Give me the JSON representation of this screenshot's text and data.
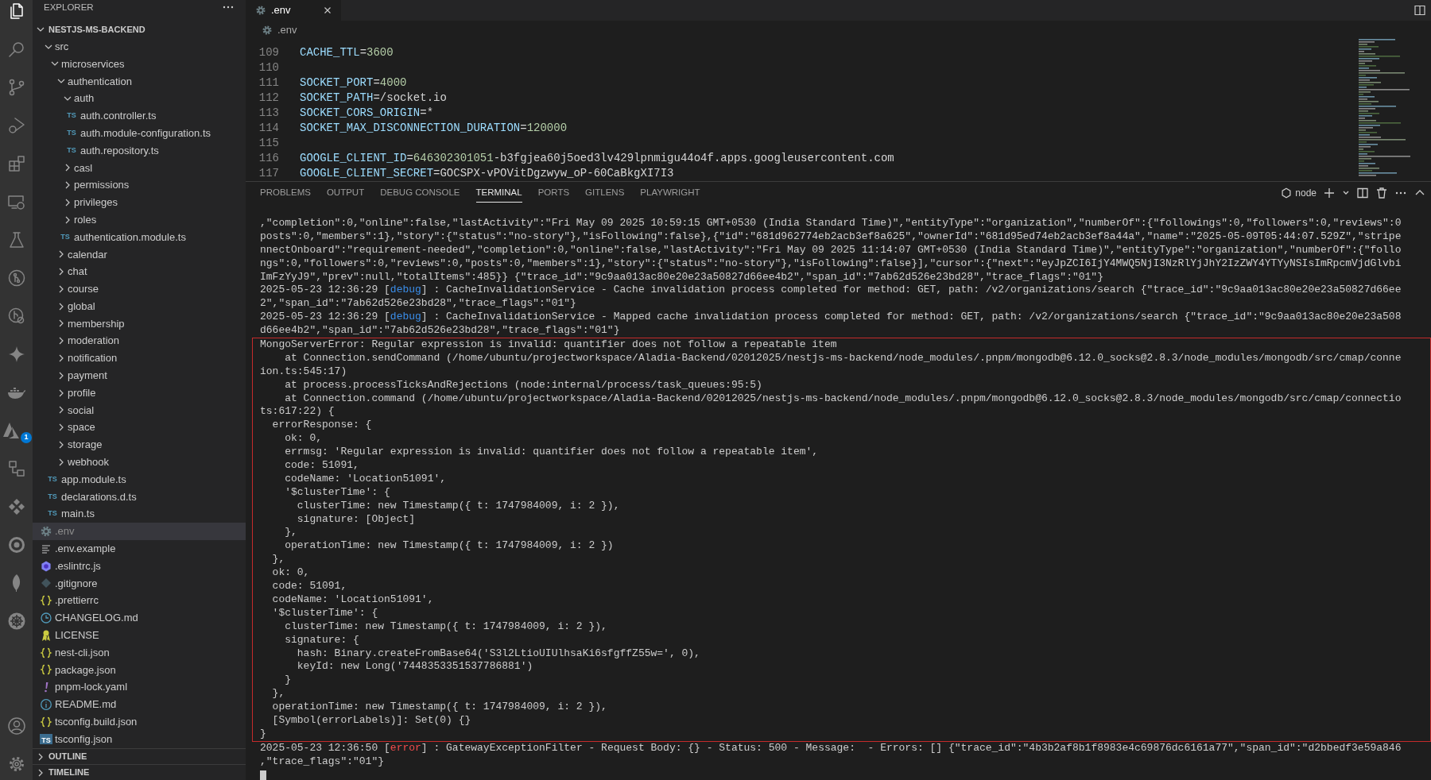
{
  "activity": {
    "items": [
      {
        "kind": "files",
        "selected": true
      },
      {
        "kind": "search",
        "selected": false
      },
      {
        "kind": "branch",
        "selected": false
      },
      {
        "kind": "run",
        "selected": false
      },
      {
        "kind": "extensions",
        "selected": false
      },
      {
        "kind": "remote",
        "selected": false
      },
      {
        "kind": "testing",
        "selected": false
      },
      {
        "kind": "graph",
        "selected": false
      },
      {
        "kind": "inspect",
        "selected": false
      },
      {
        "kind": "sparkle",
        "selected": false
      },
      {
        "kind": "whale",
        "selected": false
      },
      {
        "kind": "triangle",
        "selected": false,
        "badge": "1"
      },
      {
        "kind": "diagram",
        "selected": false
      },
      {
        "kind": "diamonds",
        "selected": false
      },
      {
        "kind": "ring",
        "selected": false
      },
      {
        "kind": "leaf",
        "selected": false
      },
      {
        "kind": "wheel",
        "selected": false
      }
    ],
    "bottom": [
      {
        "kind": "account"
      },
      {
        "kind": "settings"
      }
    ]
  },
  "sidebar": {
    "title": "EXPLORER",
    "project": {
      "label": "NESTJS-MS-BACKEND",
      "expanded": true,
      "children": [
        {
          "label": "src",
          "kind": "folder",
          "expanded": true,
          "selected": false,
          "children": [
            {
              "label": "microservices",
              "kind": "folder",
              "expanded": true,
              "selected": false,
              "children": [
                {
                  "label": "authentication",
                  "kind": "folder",
                  "expanded": true,
                  "selected": false,
                  "children": [
                    {
                      "label": "auth",
                      "kind": "folder",
                      "expanded": true,
                      "selected": false,
                      "children": [
                        {
                          "label": "auth.controller.ts",
                          "kind": "ts",
                          "icon_label": "TS",
                          "selected": false
                        },
                        {
                          "label": "auth.module-configuration.ts",
                          "kind": "ts",
                          "icon_label": "TS",
                          "selected": false
                        },
                        {
                          "label": "auth.repository.ts",
                          "kind": "ts",
                          "icon_label": "TS",
                          "selected": false
                        }
                      ]
                    },
                    {
                      "label": "casl",
                      "kind": "folder",
                      "expanded": false,
                      "selected": false
                    },
                    {
                      "label": "permissions",
                      "kind": "folder",
                      "expanded": false,
                      "selected": false
                    },
                    {
                      "label": "privileges",
                      "kind": "folder",
                      "expanded": false,
                      "selected": false
                    },
                    {
                      "label": "roles",
                      "kind": "folder",
                      "expanded": false,
                      "selected": false
                    },
                    {
                      "label": "authentication.module.ts",
                      "kind": "ts",
                      "icon_label": "TS",
                      "selected": false
                    }
                  ]
                },
                {
                  "label": "calendar",
                  "kind": "folder",
                  "expanded": false,
                  "selected": false
                },
                {
                  "label": "chat",
                  "kind": "folder",
                  "expanded": false,
                  "selected": false
                },
                {
                  "label": "course",
                  "kind": "folder",
                  "expanded": false,
                  "selected": false
                },
                {
                  "label": "global",
                  "kind": "folder",
                  "expanded": false,
                  "selected": false
                },
                {
                  "label": "membership",
                  "kind": "folder",
                  "expanded": false,
                  "selected": false
                },
                {
                  "label": "moderation",
                  "kind": "folder",
                  "expanded": false,
                  "selected": false
                },
                {
                  "label": "notification",
                  "kind": "folder",
                  "expanded": false,
                  "selected": false
                },
                {
                  "label": "payment",
                  "kind": "folder",
                  "expanded": false,
                  "selected": false
                },
                {
                  "label": "profile",
                  "kind": "folder",
                  "expanded": false,
                  "selected": false
                },
                {
                  "label": "social",
                  "kind": "folder",
                  "expanded": false,
                  "selected": false
                },
                {
                  "label": "space",
                  "kind": "folder",
                  "expanded": false,
                  "selected": false
                },
                {
                  "label": "storage",
                  "kind": "folder",
                  "expanded": false,
                  "selected": false
                },
                {
                  "label": "webhook",
                  "kind": "folder",
                  "expanded": false,
                  "selected": false
                }
              ]
            },
            {
              "label": "app.module.ts",
              "kind": "ts",
              "icon_label": "TS",
              "selected": false
            },
            {
              "label": "declarations.d.ts",
              "kind": "ts",
              "icon_label": "TS",
              "selected": false
            },
            {
              "label": "main.ts",
              "kind": "ts",
              "icon_label": "TS",
              "selected": false
            }
          ]
        },
        {
          "label": ".env",
          "kind": "settings",
          "selected": true
        },
        {
          "label": ".env.example",
          "kind": "text",
          "selected": false
        },
        {
          "label": ".eslintrc.js",
          "kind": "eslint",
          "selected": false
        },
        {
          "label": ".gitignore",
          "kind": "git",
          "selected": false
        },
        {
          "label": ".prettierrc",
          "kind": "json",
          "selected": false
        },
        {
          "label": "CHANGELOG.md",
          "kind": "changelog",
          "selected": false
        },
        {
          "label": "LICENSE",
          "kind": "license",
          "selected": false
        },
        {
          "label": "nest-cli.json",
          "kind": "json",
          "selected": false
        },
        {
          "label": "package.json",
          "kind": "json",
          "selected": false
        },
        {
          "label": "pnpm-lock.yaml",
          "kind": "yaml",
          "selected": false
        },
        {
          "label": "README.md",
          "kind": "info",
          "selected": false
        },
        {
          "label": "tsconfig.build.json",
          "kind": "json",
          "selected": false
        },
        {
          "label": "tsconfig.json",
          "kind": "tsconfig",
          "icon_label": "TS",
          "selected": false
        }
      ]
    },
    "sections": [
      {
        "label": "OUTLINE",
        "expanded": false
      },
      {
        "label": "TIMELINE",
        "expanded": false
      }
    ]
  },
  "editor": {
    "tabs": [
      {
        "label": ".env",
        "selected": true
      }
    ],
    "breadcrumb": ".env",
    "lines": [
      {
        "number": "109",
        "key": "CACHE_TTL",
        "operator": "=",
        "value": [
          {
            "text": "3600",
            "kind": "number"
          }
        ]
      },
      {
        "number": "110"
      },
      {
        "number": "111",
        "key": "SOCKET_PORT",
        "operator": "=",
        "value": [
          {
            "text": "4000",
            "kind": "number"
          }
        ]
      },
      {
        "number": "112",
        "key": "SOCKET_PATH",
        "operator": "=",
        "value": [
          {
            "text": "/socket.io",
            "kind": "text"
          }
        ]
      },
      {
        "number": "113",
        "key": "SOCKET_CORS_ORIGIN",
        "operator": "=",
        "value": [
          {
            "text": "*",
            "kind": "text"
          }
        ]
      },
      {
        "number": "114",
        "key": "SOCKET_MAX_DISCONNECTION_DURATION",
        "operator": "=",
        "value": [
          {
            "text": "120000",
            "kind": "number"
          }
        ]
      },
      {
        "number": "115"
      },
      {
        "number": "116",
        "key": "GOOGLE_CLIENT_ID",
        "operator": "=",
        "value": [
          {
            "text": "646302301051",
            "kind": "number"
          },
          {
            "text": "-b3fgjea60j5oed3lv429lpnmigu44o4f.apps.googleusercontent.com",
            "kind": "text"
          }
        ]
      },
      {
        "number": "117",
        "key": "GOOGLE_CLIENT_SECRET",
        "operator": "=",
        "value": [
          {
            "text": "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",
            "kind": "text"
          }
        ]
      }
    ]
  },
  "panel": {
    "tabs": [
      {
        "label": "PROBLEMS",
        "selected": false
      },
      {
        "label": "OUTPUT",
        "selected": false
      },
      {
        "label": "DEBUG CONSOLE",
        "selected": false
      },
      {
        "label": "TERMINAL",
        "selected": true
      },
      {
        "label": "PORTS",
        "selected": false
      },
      {
        "label": "GITLENS",
        "selected": false
      },
      {
        "label": "PLAYWRIGHT",
        "selected": false
      }
    ],
    "profile": "node",
    "blocks": [
      {
        "kind": "plain",
        "lines": [
          {
            "text": ",\"completion\":0,\"online\":false,\"lastActivity\":\"Fri May 09 2025 10:59:15 GMT+0530 (India Standard Time)\",\"entityType\":\"organization\",\"numberOf\":{\"followings\":0,\"followers\":0,\"reviews\":0"
          },
          {
            "text": "posts\":0,\"members\":1},\"story\":{\"status\":\"no-story\"},\"isFollowing\":false},{\"id\":\"681d962774eb2acb3ef8a625\",\"ownerId\":\"681d95ed74eb2acb3ef8a44a\",\"name\":\"2025-05-09T05:44:07.529Z\",\"stripe"
          },
          {
            "text": "nnectOnboard\":\"requirement-needed\",\"completion\":0,\"online\":false,\"lastActivity\":\"Fri May 09 2025 11:14:07 GMT+0530 (India Standard Time)\",\"entityType\":\"organization\",\"numberOf\":{\"follo"
          },
          {
            "text": "ngs\":0,\"followers\":0,\"reviews\":0,\"posts\":0,\"members\":1},\"story\":{\"status\":\"no-story\"},\"isFollowing\":false}],\"cursor\":{\"next\":\"eyJpZCI6IjY4MWQ5NjI3NzRlYjJhY2IzZWY4YTYyNSIsImRpcmVjdGlvbi"
          },
          {
            "text": "ImFzYyJ9\",\"prev\":null,\"totalItems\":485}} {\"trace_id\":\"9c9aa013ac80e20e23a50827d66ee4b2\",\"span_id\":\"7ab62d526e23bd28\",\"trace_flags\":\"01\"}"
          },
          {
            "parts": [
              {
                "text": "2025-05-23 12:36:29 ["
              },
              {
                "text": "debug",
                "kind": "debug"
              },
              {
                "text": "] : CacheInvalidationService - Cache invalidation process completed for method: GET, path: /v2/organizations/search {\"trace_id\":\"9c9aa013ac80e20e23a50827d66ee"
              }
            ]
          },
          {
            "text": "2\",\"span_id\":\"7ab62d526e23bd28\",\"trace_flags\":\"01\"}"
          },
          {
            "parts": [
              {
                "text": "2025-05-23 12:36:29 ["
              },
              {
                "text": "debug",
                "kind": "debug"
              },
              {
                "text": "] : CacheInvalidationService - Mapped cache invalidation process completed for method: GET, path: /v2/organizations/search {\"trace_id\":\"9c9aa013ac80e20e23a508"
              }
            ]
          },
          {
            "text": "d66ee4b2\",\"span_id\":\"7ab62d526e23bd28\",\"trace_flags\":\"01\"}"
          }
        ]
      },
      {
        "kind": "framed",
        "lines": [
          {
            "text": "MongoServerError: Regular expression is invalid: quantifier does not follow a repeatable item"
          },
          {
            "text": "    at Connection.sendCommand (/home/ubuntu/projectworkspace/Aladia-Backend/02012025/nestjs-ms-backend/node_modules/.pnpm/mongodb@6.12.0_socks@2.8.3/node_modules/mongodb/src/cmap/conne"
          },
          {
            "text": "ion.ts:545:17)"
          },
          {
            "text": "    at process.processTicksAndRejections (node:internal/process/task_queues:95:5)"
          },
          {
            "text": "    at Connection.command (/home/ubuntu/projectworkspace/Aladia-Backend/02012025/nestjs-ms-backend/node_modules/.pnpm/mongodb@6.12.0_socks@2.8.3/node_modules/mongodb/src/cmap/connectio"
          },
          {
            "text": "ts:617:22) {"
          },
          {
            "text": "  errorResponse: {"
          },
          {
            "text": "    ok: 0,"
          },
          {
            "text": "    errmsg: 'Regular expression is invalid: quantifier does not follow a repeatable item',"
          },
          {
            "text": "    code: 51091,"
          },
          {
            "text": "    codeName: 'Location51091',"
          },
          {
            "text": "    '$clusterTime': {"
          },
          {
            "text": "      clusterTime: new Timestamp({ t: 1747984009, i: 2 }),"
          },
          {
            "text": "      signature: [Object]"
          },
          {
            "text": "    },"
          },
          {
            "text": "    operationTime: new Timestamp({ t: 1747984009, i: 2 })"
          },
          {
            "text": "  },"
          },
          {
            "text": "  ok: 0,"
          },
          {
            "text": "  code: 51091,"
          },
          {
            "text": "  codeName: 'Location51091',"
          },
          {
            "text": "  '$clusterTime': {"
          },
          {
            "text": "    clusterTime: new Timestamp({ t: 1747984009, i: 2 }),"
          },
          {
            "text": "    signature: {"
          },
          {
            "text": "      hash: Binary.createFromBase64('S3l2LtioUIUlhsaKi6sfgffZ55w=', 0),"
          },
          {
            "text": "      keyId: new Long('7448353351537786881')"
          },
          {
            "text": "    }"
          },
          {
            "text": "  },"
          },
          {
            "text": "  operationTime: new Timestamp({ t: 1747984009, i: 2 }),"
          },
          {
            "text": "  [Symbol(errorLabels)]: Set(0) {}"
          },
          {
            "text": "}"
          }
        ]
      },
      {
        "kind": "plain",
        "lines": [
          {
            "parts": [
              {
                "text": "2025-05-23 12:36:50 ["
              },
              {
                "text": "error",
                "kind": "error"
              },
              {
                "text": "] : GatewayExceptionFilter - Request Body: {} - Status: 500 - Message:  - Errors: [] {\"trace_id\":\"4b3b2af8b1f8983e4c69876dc6161a77\",\"span_id\":\"d2bbedf3e59a846"
              }
            ]
          },
          {
            "text": ",\"trace_flags\":\"01\"}"
          }
        ]
      }
    ]
  }
}
